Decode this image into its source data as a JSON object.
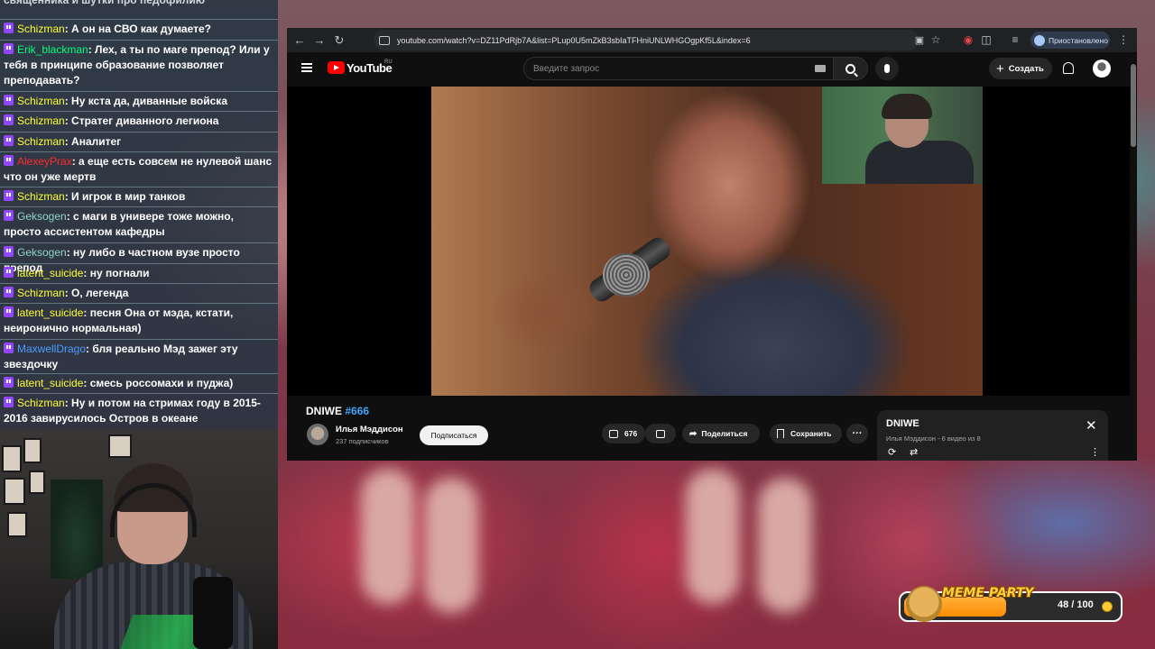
{
  "chat": {
    "top_fragment": "священника и шутки про педофилию",
    "messages": [
      {
        "user": "Schizman",
        "color": "#ffff33",
        "text": "А он на СВО как думаете?"
      },
      {
        "user": "Erik_blackman",
        "color": "#00ff7f",
        "text": "Лех, а ты по маге препод? Или у тебя в принципе образование позволяет преподавать?"
      },
      {
        "user": "Schizman",
        "color": "#ffff33",
        "text": "Ну кста да, диванные войска"
      },
      {
        "user": "Schizman",
        "color": "#ffff33",
        "text": "Стратег диванного легиона"
      },
      {
        "user": "Schizman",
        "color": "#ffff33",
        "text": "Аналитег"
      },
      {
        "user": "AlexeyPrax",
        "color": "#ff2a2a",
        "text": "а еще есть совсем не нулевой шанс что он уже мертв"
      },
      {
        "user": "Schizman",
        "color": "#ffff33",
        "text": "И игрок в мир танков"
      },
      {
        "user": "Geksogen",
        "color": "#8fd3c8",
        "text": "с маги в универе тоже можно, просто ассистентом кафедры"
      },
      {
        "user": "Geksogen",
        "color": "#8fd3c8",
        "text": "ну либо в частном вузе просто препод"
      },
      {
        "user": "latent_suicide",
        "color": "#ffff33",
        "text": "ну погнали"
      },
      {
        "user": "Schizman",
        "color": "#ffff33",
        "text": "О, легенда"
      },
      {
        "user": "latent_suicide",
        "color": "#ffff33",
        "text": "песня Она от мэда, кстати, неиронично нормальная)"
      },
      {
        "user": "MaxwellDrago",
        "color": "#4a9cff",
        "text": "бля реально Мэд зажег эту звездочку"
      },
      {
        "user": "latent_suicide",
        "color": "#ffff33",
        "text": "смесь россомахи и пуджа)"
      },
      {
        "user": "Schizman",
        "color": "#ffff33",
        "text": "Ну и потом на стримах году в 2015-2016 завирусилось Остров в океане"
      }
    ]
  },
  "browser": {
    "url": "youtube.com/watch?v=DZ11PdRjb7A&list=PLup0U5mZkB3sbIaTFHniUNLWHGOgpKf5L&index=6",
    "profile_label": "Приостановлено",
    "nav_icons": [
      "back-icon",
      "forward-icon",
      "reload-icon",
      "site-info-icon"
    ]
  },
  "youtube": {
    "logo_text": "YouTube",
    "country_code": "RU",
    "search_placeholder": "Введите запрос",
    "create_label": "Создать",
    "video": {
      "title": "DNIWE",
      "hashtag": "#666",
      "channel_name": "Илья Мэддисон",
      "subscribers": "237 подписчиков",
      "subscribe_label": "Подписаться",
      "likes": "676",
      "share_label": "Поделиться",
      "save_label": "Сохранить",
      "more_label": "···"
    },
    "playlist": {
      "title": "DNIWE",
      "meta": "Илья Мэддисон - 6 видео из 8"
    }
  },
  "meme_party": {
    "title": "MEME PARTY",
    "count": "48 / 100",
    "progress": 0.48
  }
}
